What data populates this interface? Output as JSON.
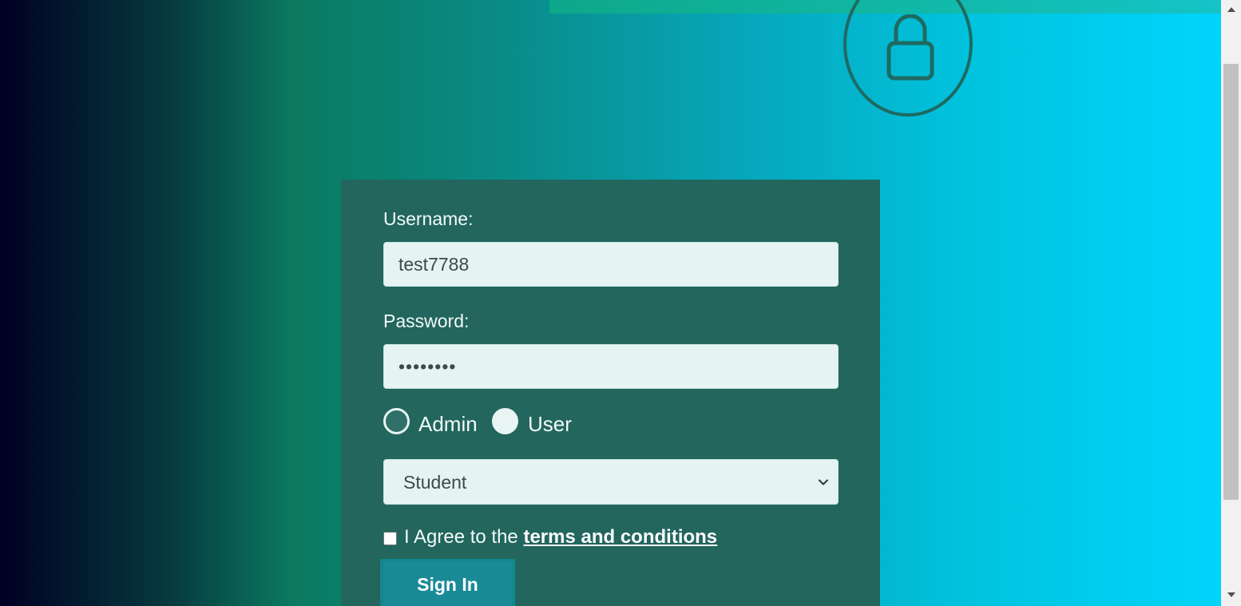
{
  "login_form": {
    "username_label": "Username:",
    "username_value": "test7788",
    "password_label": "Password:",
    "password_value": "••••••••",
    "role_options": [
      {
        "label": "Admin",
        "selected": true
      },
      {
        "label": "User",
        "selected": false
      }
    ],
    "type_select": {
      "selected": "Student"
    },
    "agree_checked": false,
    "agree_prefix": "I Agree to the",
    "terms_link": "terms and conditions",
    "submit_label": "Sign In"
  },
  "icons": {
    "lock": "lock-icon",
    "select_chevron": "chevron-down-icon",
    "scroll_up": "scroll-up-arrow-icon",
    "scroll_down": "scroll-down-arrow-icon"
  },
  "colors": {
    "card_bg": "#22665e",
    "input_bg": "#e5f4f3",
    "button_bg": "#1a8a96",
    "lock_stroke": "#1e6a62",
    "gradient_start": "#000022",
    "gradient_end": "#00d4fc"
  }
}
